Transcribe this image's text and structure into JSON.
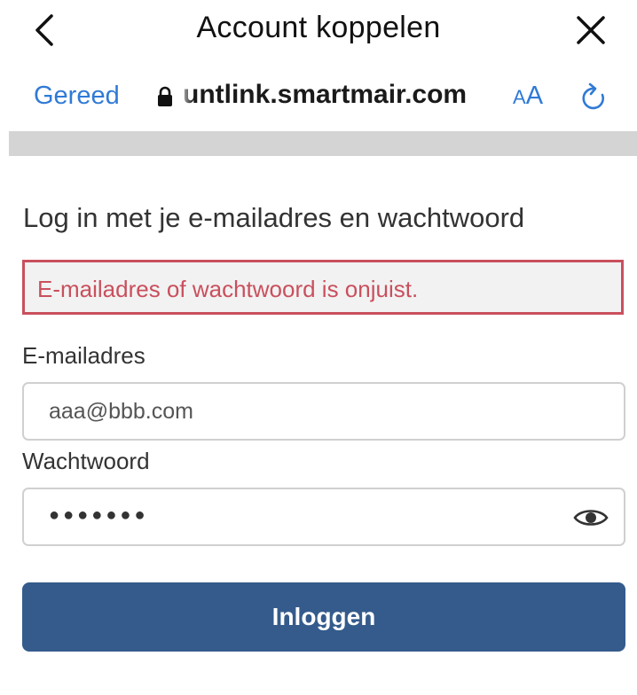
{
  "header": {
    "title": "Account koppelen"
  },
  "browser": {
    "done_label": "Gereed",
    "url": "untlink.smartmair.com",
    "text_size_small": "A",
    "text_size_large": "A"
  },
  "form": {
    "heading": "Log in met je e-mailadres en wachtwoord",
    "error_message": "E-mailadres of wachtwoord is onjuist.",
    "email_label": "E-mailadres",
    "email_value": "aaa@bbb.com",
    "password_label": "Wachtwoord",
    "password_masked": "●●●●●●●",
    "submit_label": "Inloggen"
  },
  "colors": {
    "link_blue": "#2f7ad6",
    "error_red": "#c9505d",
    "button_blue": "#345b8c"
  }
}
